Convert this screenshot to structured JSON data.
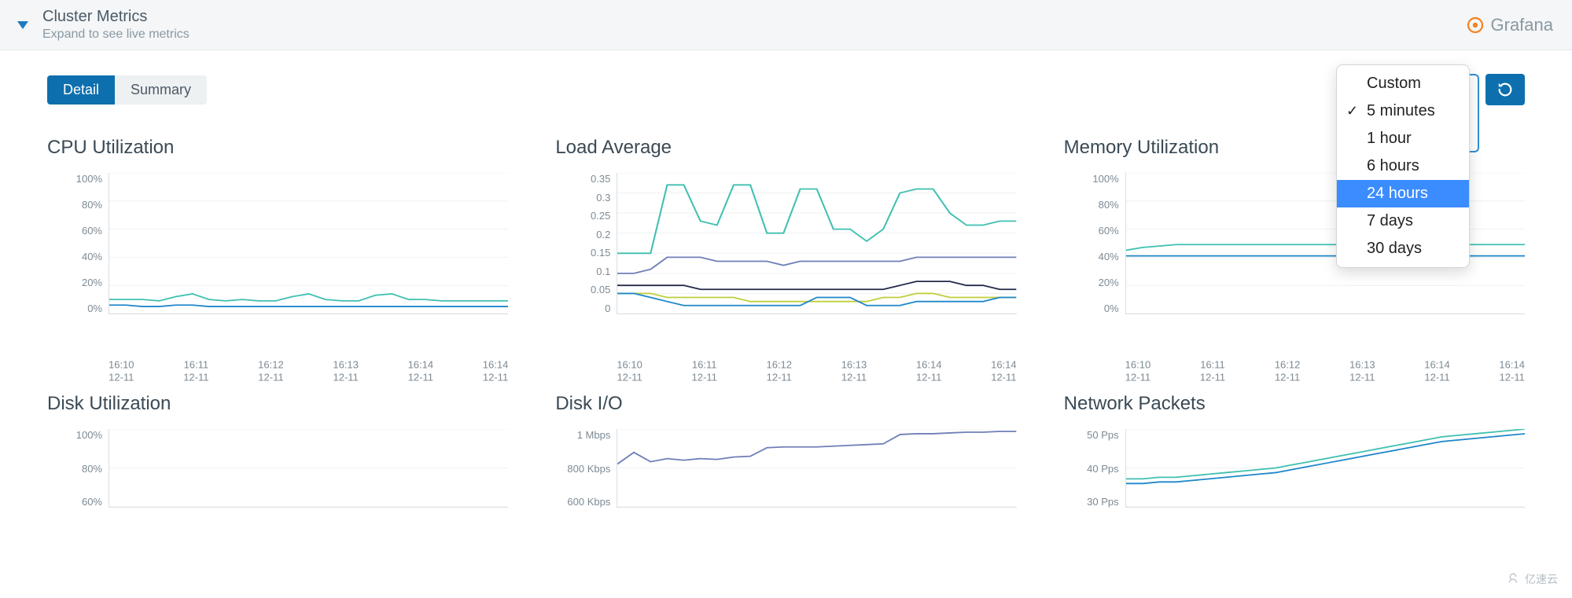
{
  "header": {
    "title": "Cluster Metrics",
    "subtitle": "Expand to see live metrics",
    "grafana_label": "Grafana"
  },
  "tabs": {
    "detail": "Detail",
    "summary": "Summary",
    "active": "detail"
  },
  "time_menu": {
    "items": [
      "Custom",
      "5 minutes",
      "1 hour",
      "6 hours",
      "24 hours",
      "7 days",
      "30 days"
    ],
    "selected": "5 minutes",
    "hovered": "24 hours"
  },
  "x_ticks": [
    {
      "t": "16:10",
      "d": "12-11"
    },
    {
      "t": "16:11",
      "d": "12-11"
    },
    {
      "t": "16:12",
      "d": "12-11"
    },
    {
      "t": "16:13",
      "d": "12-11"
    },
    {
      "t": "16:14",
      "d": "12-11"
    },
    {
      "t": "16:14",
      "d": "12-11"
    }
  ],
  "chart_data": [
    {
      "id": "cpu",
      "title": "CPU Utilization",
      "type": "line",
      "ylabel": "%",
      "ylim": [
        0,
        100
      ],
      "y_ticks": [
        "100%",
        "80%",
        "60%",
        "40%",
        "20%",
        "0%"
      ],
      "series": [
        {
          "name": "s1",
          "color": "#3fc0b0",
          "values": [
            10,
            10,
            10,
            9,
            12,
            14,
            10,
            9,
            10,
            9,
            9,
            12,
            14,
            10,
            9,
            9,
            13,
            14,
            10,
            10,
            9,
            9,
            9,
            9,
            9
          ]
        },
        {
          "name": "s2",
          "color": "#1f87c9",
          "values": [
            6,
            6,
            5,
            5,
            6,
            6,
            5,
            5,
            5,
            5,
            5,
            5,
            5,
            5,
            5,
            5,
            5,
            5,
            5,
            5,
            5,
            5,
            5,
            5,
            5
          ]
        }
      ]
    },
    {
      "id": "load",
      "title": "Load Average",
      "type": "line",
      "ylabel": "",
      "ylim": [
        0,
        0.35
      ],
      "y_ticks": [
        "0.35",
        "0.3",
        "0.25",
        "0.2",
        "0.15",
        "0.1",
        "0.05",
        "0"
      ],
      "series": [
        {
          "name": "s1",
          "color": "#3fc0b0",
          "values": [
            0.15,
            0.15,
            0.15,
            0.32,
            0.32,
            0.23,
            0.22,
            0.32,
            0.32,
            0.2,
            0.2,
            0.31,
            0.31,
            0.21,
            0.21,
            0.18,
            0.21,
            0.3,
            0.31,
            0.31,
            0.25,
            0.22,
            0.22,
            0.23,
            0.23
          ]
        },
        {
          "name": "s2",
          "color": "#6f7fb8",
          "values": [
            0.1,
            0.1,
            0.11,
            0.14,
            0.14,
            0.14,
            0.13,
            0.13,
            0.13,
            0.13,
            0.12,
            0.13,
            0.13,
            0.13,
            0.13,
            0.13,
            0.13,
            0.13,
            0.14,
            0.14,
            0.14,
            0.14,
            0.14,
            0.14,
            0.14
          ]
        },
        {
          "name": "s3",
          "color": "#232a4a",
          "values": [
            0.07,
            0.07,
            0.07,
            0.07,
            0.07,
            0.06,
            0.06,
            0.06,
            0.06,
            0.06,
            0.06,
            0.06,
            0.06,
            0.06,
            0.06,
            0.06,
            0.06,
            0.07,
            0.08,
            0.08,
            0.08,
            0.07,
            0.07,
            0.06,
            0.06
          ]
        },
        {
          "name": "s4",
          "color": "#bfcf3a",
          "values": [
            0.05,
            0.05,
            0.05,
            0.04,
            0.04,
            0.04,
            0.04,
            0.04,
            0.03,
            0.03,
            0.03,
            0.03,
            0.03,
            0.03,
            0.03,
            0.03,
            0.04,
            0.04,
            0.05,
            0.05,
            0.04,
            0.04,
            0.04,
            0.04,
            0.04
          ]
        },
        {
          "name": "s5",
          "color": "#1f87c9",
          "values": [
            0.05,
            0.05,
            0.04,
            0.03,
            0.02,
            0.02,
            0.02,
            0.02,
            0.02,
            0.02,
            0.02,
            0.02,
            0.04,
            0.04,
            0.04,
            0.02,
            0.02,
            0.02,
            0.03,
            0.03,
            0.03,
            0.03,
            0.03,
            0.04,
            0.04
          ]
        }
      ]
    },
    {
      "id": "mem",
      "title": "Memory Utilization",
      "type": "line",
      "ylabel": "%",
      "ylim": [
        0,
        100
      ],
      "y_ticks": [
        "100%",
        "80%",
        "60%",
        "40%",
        "20%",
        "0%"
      ],
      "series": [
        {
          "name": "s1",
          "color": "#3fc0b0",
          "values": [
            45,
            47,
            48,
            49,
            49,
            49,
            49,
            49,
            49,
            49,
            49,
            49,
            49,
            49,
            49,
            49,
            49,
            49,
            49,
            49,
            49,
            49,
            49,
            49,
            49
          ]
        },
        {
          "name": "s2",
          "color": "#1f87c9",
          "values": [
            41,
            41,
            41,
            41,
            41,
            41,
            41,
            41,
            41,
            41,
            41,
            41,
            41,
            41,
            41,
            41,
            41,
            41,
            41,
            41,
            41,
            41,
            41,
            41,
            41
          ]
        }
      ]
    },
    {
      "id": "disk",
      "title": "Disk Utilization",
      "type": "line",
      "ylabel": "%",
      "ylim": [
        0,
        100
      ],
      "y_ticks": [
        "100%",
        "80%",
        "60%"
      ],
      "series": []
    },
    {
      "id": "diskio",
      "title": "Disk I/O",
      "type": "line",
      "ylabel": "",
      "ylim": [
        0,
        1000
      ],
      "y_ticks": [
        "1 Mbps",
        "800 Kbps",
        "600 Kbps"
      ],
      "series": [
        {
          "name": "s1",
          "color": "#6f7fb8",
          "values": [
            550,
            700,
            580,
            620,
            600,
            620,
            610,
            640,
            650,
            760,
            770,
            770,
            770,
            780,
            790,
            800,
            810,
            930,
            940,
            940,
            950,
            960,
            960,
            970,
            970
          ]
        }
      ]
    },
    {
      "id": "net",
      "title": "Network Packets",
      "type": "line",
      "ylabel": "",
      "ylim": [
        0,
        50
      ],
      "y_ticks": [
        "50 Pps",
        "40 Pps",
        "30 Pps"
      ],
      "series": [
        {
          "name": "s1",
          "color": "#3fc0b0",
          "values": [
            18,
            18,
            19,
            19,
            20,
            21,
            22,
            23,
            24,
            25,
            27,
            29,
            31,
            33,
            35,
            37,
            39,
            41,
            43,
            45,
            46,
            47,
            48,
            49,
            50
          ]
        },
        {
          "name": "s2",
          "color": "#1f87c9",
          "values": [
            15,
            15,
            16,
            16,
            17,
            18,
            19,
            20,
            21,
            22,
            24,
            26,
            28,
            30,
            32,
            34,
            36,
            38,
            40,
            42,
            43,
            44,
            45,
            46,
            47
          ]
        }
      ]
    }
  ],
  "watermark": "亿速云"
}
